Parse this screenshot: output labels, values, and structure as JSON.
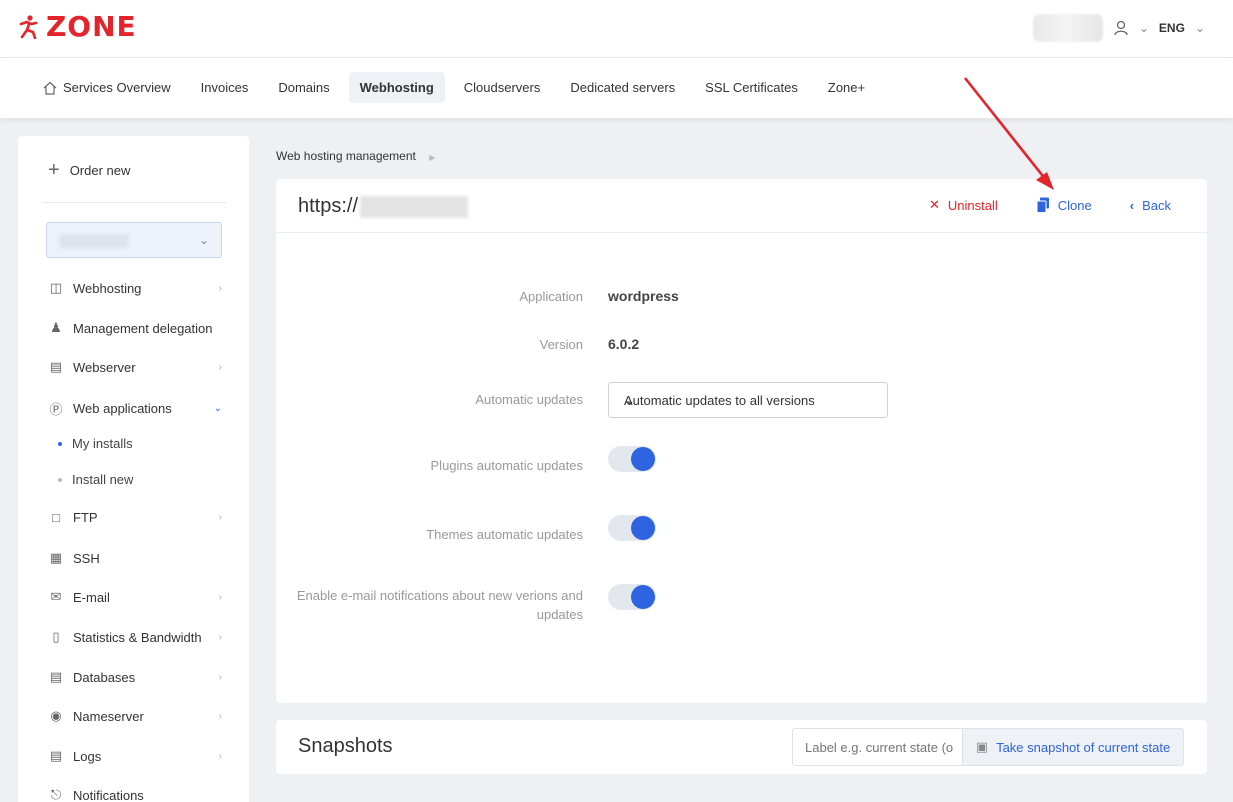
{
  "brand": {
    "logo_text": "ZONE",
    "accent": "#e3242b"
  },
  "top_right": {
    "language": "ENG"
  },
  "nav": {
    "items": [
      {
        "label": "Services Overview",
        "icon": "home-icon"
      },
      {
        "label": "Invoices"
      },
      {
        "label": "Domains"
      },
      {
        "label": "Webhosting",
        "active": true
      },
      {
        "label": "Cloudservers"
      },
      {
        "label": "Dedicated servers"
      },
      {
        "label": "SSL Certificates"
      },
      {
        "label": "Zone+"
      }
    ]
  },
  "sidebar": {
    "order_new": "Order new",
    "items": [
      {
        "label": "Webhosting",
        "icon": "monitor-icon"
      },
      {
        "label": "Management delegation",
        "icon": "user-plus-icon"
      },
      {
        "label": "Webserver",
        "icon": "server-icon"
      },
      {
        "label": "Web applications",
        "icon": "wordpress-icon"
      },
      {
        "label": "My installs"
      },
      {
        "label": "Install new"
      },
      {
        "label": "FTP",
        "icon": "file-icon"
      },
      {
        "label": "SSH",
        "icon": "terminal-icon"
      },
      {
        "label": "E-mail",
        "icon": "mail-icon"
      },
      {
        "label": "Statistics & Bandwidth",
        "icon": "bar-chart-icon"
      },
      {
        "label": "Databases",
        "icon": "database-icon"
      },
      {
        "label": "Nameserver",
        "icon": "dns-icon"
      },
      {
        "label": "Logs",
        "icon": "archive-icon"
      },
      {
        "label": "Notifications",
        "icon": "bell-icon"
      }
    ]
  },
  "breadcrumb": {
    "label": "Web hosting management"
  },
  "card": {
    "url_prefix": "https://",
    "uninstall": "Uninstall",
    "clone": "Clone",
    "back": "Back",
    "application_label": "Application",
    "application_value": "wordpress",
    "version_label": "Version",
    "version_value": "6.0.2",
    "auto_updates_label": "Automatic updates",
    "auto_updates_value": "Automatic updates to all versions",
    "plugins_label": "Plugins automatic updates",
    "themes_label": "Themes automatic updates",
    "notify_label_1": "Enable e-mail notifications about new verions and",
    "notify_label_2": "updates",
    "toggles": {
      "plugins": true,
      "themes": true,
      "notifications": true
    }
  },
  "snapshots": {
    "title": "Snapshots",
    "placeholder": "Label e.g. current state (o",
    "button": "Take snapshot of current state"
  }
}
